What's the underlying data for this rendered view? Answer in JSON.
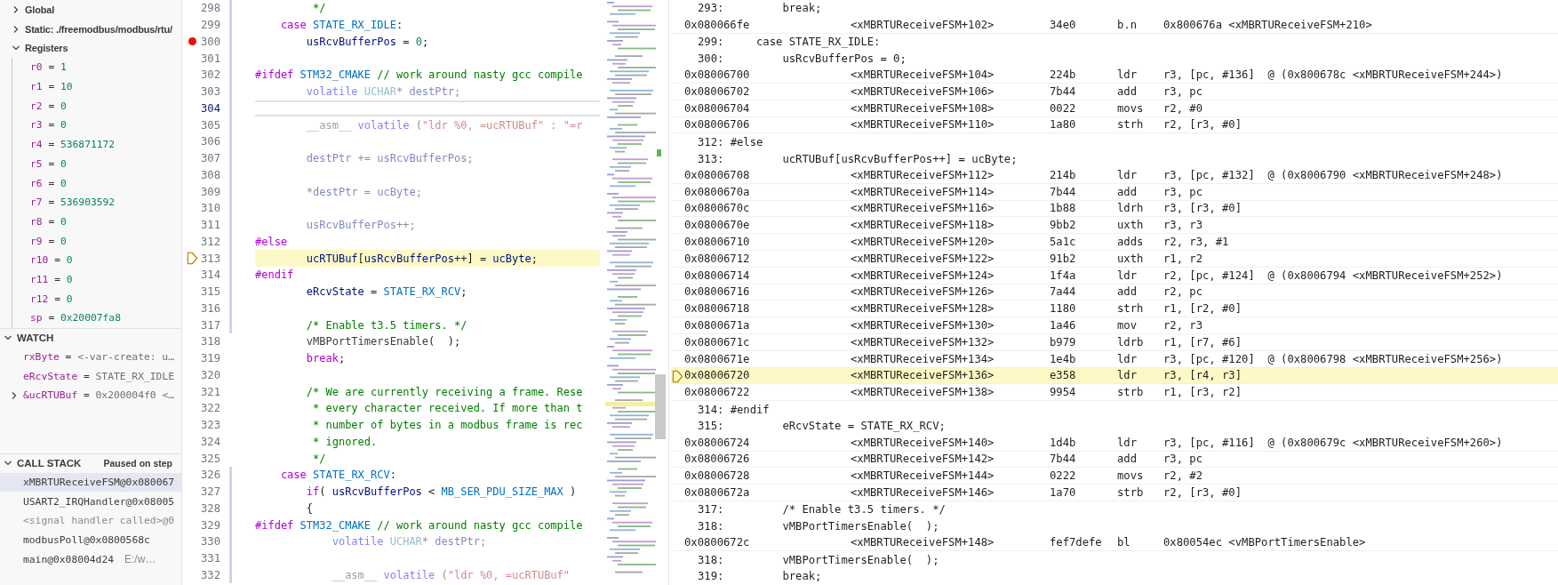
{
  "sidebar": {
    "scopes": [
      {
        "label": "Global",
        "expanded": false
      },
      {
        "label": "Static: ./freemodbus/modbus/rtu/",
        "expanded": false
      },
      {
        "label": "Registers",
        "expanded": true,
        "children": [
          {
            "name": "r0",
            "operator": "=",
            "value": "1"
          },
          {
            "name": "r1",
            "operator": "=",
            "value": "10"
          },
          {
            "name": "r2",
            "operator": "=",
            "value": "0"
          },
          {
            "name": "r3",
            "operator": "=",
            "value": "0"
          },
          {
            "name": "r4",
            "operator": "=",
            "value": "536871172"
          },
          {
            "name": "r5",
            "operator": "=",
            "value": "0"
          },
          {
            "name": "r6",
            "operator": "=",
            "value": "0"
          },
          {
            "name": "r7",
            "operator": "=",
            "value": "536903592"
          },
          {
            "name": "r8",
            "operator": "=",
            "value": "0"
          },
          {
            "name": "r9",
            "operator": "=",
            "value": "0"
          },
          {
            "name": "r10",
            "operator": "=",
            "value": "0"
          },
          {
            "name": "r11",
            "operator": "=",
            "value": "0"
          },
          {
            "name": "r12",
            "operator": "=",
            "value": "0"
          },
          {
            "name": "sp",
            "operator": "=",
            "value": "0x20007fa8"
          }
        ]
      }
    ],
    "watch": {
      "title": "WATCH",
      "expanded": true,
      "items": [
        {
          "name": "rxByte",
          "operator": "=",
          "value": "<-var-create: u…",
          "expandable": false
        },
        {
          "name": "eRcvState",
          "operator": "=",
          "value": "STATE_RX_IDLE",
          "expandable": false
        },
        {
          "name": "&ucRTUBuf",
          "operator": "=",
          "value": "0x200004f0 <…",
          "expandable": true
        }
      ]
    },
    "call_stack": {
      "title": "CALL STACK",
      "expanded": true,
      "status": "Paused on step",
      "frames": [
        {
          "label": "xMBRTUReceiveFSM@0x080067",
          "selected": true,
          "dimmed": false
        },
        {
          "label": "USART2_IRQHandler@0x08005",
          "selected": false,
          "dimmed": false
        },
        {
          "label": "<signal handler called>@0",
          "selected": false,
          "dimmed": true
        },
        {
          "label": "modbusPoll@0x0800568c",
          "selected": false,
          "dimmed": false
        },
        {
          "label": "main@0x08004d24",
          "source": "E:/w…",
          "selected": false,
          "dimmed": false
        }
      ]
    }
  },
  "editor": {
    "lines": [
      {
        "number": "298",
        "breakpoint": false,
        "current": false,
        "cursor": false,
        "inactive": false,
        "modified": true,
        "segments": [
          {
            "kind": "comment",
            "text": "         */"
          }
        ]
      },
      {
        "number": "299",
        "breakpoint": false,
        "current": false,
        "cursor": false,
        "inactive": false,
        "modified": true,
        "segments": [
          {
            "kind": "keyword",
            "text": "    case "
          },
          {
            "kind": "constant",
            "text": "STATE_RX_IDLE"
          },
          {
            "kind": "plain",
            "text": ":"
          }
        ]
      },
      {
        "number": "300",
        "breakpoint": true,
        "current": false,
        "cursor": false,
        "inactive": false,
        "modified": true,
        "segments": [
          {
            "kind": "variable",
            "text": "        usRcvBufferPos"
          },
          {
            "kind": "plain",
            "text": " = "
          },
          {
            "kind": "number",
            "text": "0"
          },
          {
            "kind": "plain",
            "text": ";"
          }
        ]
      },
      {
        "number": "301",
        "breakpoint": false,
        "current": false,
        "cursor": false,
        "modified": true
      },
      {
        "number": "302",
        "breakpoint": false,
        "current": false,
        "cursor": false,
        "inactive": false,
        "modified": true,
        "segments": [
          {
            "kind": "directive",
            "text": "#ifdef "
          },
          {
            "kind": "constant",
            "text": "STM32_CMAKE"
          },
          {
            "kind": "comment",
            "text": " // work around nasty gcc compile"
          }
        ]
      },
      {
        "number": "303",
        "breakpoint": false,
        "current": false,
        "cursor": false,
        "inactive": true,
        "modified": true,
        "segments": [
          {
            "kind": "storage",
            "text": "        volatile "
          },
          {
            "kind": "type",
            "text": "UCHAR"
          },
          {
            "kind": "plain",
            "text": "* "
          },
          {
            "kind": "variable",
            "text": "destPtr"
          },
          {
            "kind": "plain",
            "text": ";"
          }
        ]
      },
      {
        "number": "304",
        "breakpoint": false,
        "current": false,
        "cursor": true,
        "modified": true
      },
      {
        "number": "305",
        "breakpoint": false,
        "current": false,
        "cursor": false,
        "inactive": true,
        "modified": true,
        "segments": [
          {
            "kind": "function",
            "text": "        __asm__"
          },
          {
            "kind": "storage",
            "text": " volatile"
          },
          {
            "kind": "plain",
            "text": " ("
          },
          {
            "kind": "string",
            "text": "\"ldr %0, =ucRTUBuf\""
          },
          {
            "kind": "plain",
            "text": " : "
          },
          {
            "kind": "string",
            "text": "\"=r"
          }
        ]
      },
      {
        "number": "306",
        "breakpoint": false,
        "current": false,
        "cursor": false,
        "modified": true
      },
      {
        "number": "307",
        "breakpoint": false,
        "current": false,
        "cursor": false,
        "inactive": true,
        "modified": true,
        "segments": [
          {
            "kind": "variable",
            "text": "        destPtr"
          },
          {
            "kind": "plain",
            "text": " += "
          },
          {
            "kind": "variable",
            "text": "usRcvBufferPos"
          },
          {
            "kind": "plain",
            "text": ";"
          }
        ]
      },
      {
        "number": "308",
        "breakpoint": false,
        "current": false,
        "cursor": false,
        "modified": true
      },
      {
        "number": "309",
        "breakpoint": false,
        "current": false,
        "cursor": false,
        "inactive": true,
        "modified": true,
        "segments": [
          {
            "kind": "plain",
            "text": "        *"
          },
          {
            "kind": "variable",
            "text": "destPtr"
          },
          {
            "kind": "plain",
            "text": " = "
          },
          {
            "kind": "variable",
            "text": "ucByte"
          },
          {
            "kind": "plain",
            "text": ";"
          }
        ]
      },
      {
        "number": "310",
        "breakpoint": false,
        "current": false,
        "cursor": false,
        "modified": true
      },
      {
        "number": "311",
        "breakpoint": false,
        "current": false,
        "cursor": false,
        "inactive": true,
        "modified": true,
        "segments": [
          {
            "kind": "variable",
            "text": "        usRcvBufferPos"
          },
          {
            "kind": "plain",
            "text": "++;"
          }
        ]
      },
      {
        "number": "312",
        "breakpoint": false,
        "current": false,
        "cursor": false,
        "inactive": false,
        "modified": true,
        "segments": [
          {
            "kind": "directive",
            "text": "#else"
          }
        ]
      },
      {
        "number": "313",
        "breakpoint": false,
        "current": true,
        "cursor": false,
        "inactive": false,
        "modified": true,
        "segments": [
          {
            "kind": "variable",
            "text": "        ucRTUBuf"
          },
          {
            "kind": "plain",
            "text": "["
          },
          {
            "kind": "variable",
            "text": "usRcvBufferPos"
          },
          {
            "kind": "plain",
            "text": "++] = "
          },
          {
            "kind": "variable",
            "text": "ucByte"
          },
          {
            "kind": "plain",
            "text": ";"
          }
        ]
      },
      {
        "number": "314",
        "breakpoint": false,
        "current": false,
        "cursor": false,
        "inactive": false,
        "modified": true,
        "segments": [
          {
            "kind": "directive",
            "text": "#endif"
          }
        ]
      },
      {
        "number": "315",
        "breakpoint": false,
        "current": false,
        "cursor": false,
        "inactive": false,
        "modified": true,
        "segments": [
          {
            "kind": "variable",
            "text": "        eRcvState"
          },
          {
            "kind": "plain",
            "text": " = "
          },
          {
            "kind": "constant",
            "text": "STATE_RX_RCV"
          },
          {
            "kind": "plain",
            "text": ";"
          }
        ]
      },
      {
        "number": "316",
        "breakpoint": false,
        "current": false,
        "cursor": false,
        "modified": true
      },
      {
        "number": "317",
        "breakpoint": false,
        "current": false,
        "cursor": false,
        "inactive": false,
        "modified": true,
        "segments": [
          {
            "kind": "comment",
            "text": "        /* Enable t3.5 timers. */"
          }
        ]
      },
      {
        "number": "318",
        "breakpoint": false,
        "current": false,
        "cursor": false,
        "inactive": false,
        "modified": false,
        "segments": [
          {
            "kind": "function",
            "text": "        vMBPortTimersEnable"
          },
          {
            "kind": "plain",
            "text": "(  );"
          }
        ]
      },
      {
        "number": "319",
        "breakpoint": false,
        "current": false,
        "cursor": false,
        "inactive": false,
        "modified": false,
        "segments": [
          {
            "kind": "keyword",
            "text": "        break"
          },
          {
            "kind": "plain",
            "text": ";"
          }
        ]
      },
      {
        "number": "320",
        "breakpoint": false,
        "current": false,
        "cursor": false,
        "modified": false
      },
      {
        "number": "321",
        "breakpoint": false,
        "current": false,
        "cursor": false,
        "inactive": false,
        "modified": false,
        "segments": [
          {
            "kind": "comment",
            "text": "        /* We are currently receiving a frame. Rese"
          }
        ]
      },
      {
        "number": "322",
        "breakpoint": false,
        "current": false,
        "cursor": false,
        "inactive": false,
        "modified": false,
        "segments": [
          {
            "kind": "comment",
            "text": "         * every character received. If more than t"
          }
        ]
      },
      {
        "number": "323",
        "breakpoint": false,
        "current": false,
        "cursor": false,
        "inactive": false,
        "modified": false,
        "segments": [
          {
            "kind": "comment",
            "text": "         * number of bytes in a modbus frame is rec"
          }
        ]
      },
      {
        "number": "324",
        "breakpoint": false,
        "current": false,
        "cursor": false,
        "inactive": false,
        "modified": false,
        "segments": [
          {
            "kind": "comment",
            "text": "         * ignored."
          }
        ]
      },
      {
        "number": "325",
        "breakpoint": false,
        "current": false,
        "cursor": false,
        "inactive": false,
        "modified": false,
        "segments": [
          {
            "kind": "comment",
            "text": "         */"
          }
        ]
      },
      {
        "number": "326",
        "breakpoint": false,
        "current": false,
        "cursor": false,
        "inactive": false,
        "modified": true,
        "segments": [
          {
            "kind": "keyword",
            "text": "    case "
          },
          {
            "kind": "constant",
            "text": "STATE_RX_RCV"
          },
          {
            "kind": "plain",
            "text": ":"
          }
        ]
      },
      {
        "number": "327",
        "breakpoint": false,
        "current": false,
        "cursor": false,
        "inactive": false,
        "modified": true,
        "segments": [
          {
            "kind": "keyword",
            "text": "        if"
          },
          {
            "kind": "plain",
            "text": "( "
          },
          {
            "kind": "variable",
            "text": "usRcvBufferPos"
          },
          {
            "kind": "plain",
            "text": " < "
          },
          {
            "kind": "constant",
            "text": "MB_SER_PDU_SIZE_MAX"
          },
          {
            "kind": "plain",
            "text": " )"
          }
        ]
      },
      {
        "number": "328",
        "breakpoint": false,
        "current": false,
        "cursor": false,
        "inactive": false,
        "modified": true,
        "segments": [
          {
            "kind": "plain",
            "text": "        {"
          }
        ]
      },
      {
        "number": "329",
        "breakpoint": false,
        "current": false,
        "cursor": false,
        "inactive": false,
        "modified": true,
        "segments": [
          {
            "kind": "directive",
            "text": "#ifdef "
          },
          {
            "kind": "constant",
            "text": "STM32_CMAKE"
          },
          {
            "kind": "comment",
            "text": " // work around nasty gcc compile"
          }
        ]
      },
      {
        "number": "330",
        "breakpoint": false,
        "current": false,
        "cursor": false,
        "inactive": true,
        "modified": true,
        "segments": [
          {
            "kind": "storage",
            "text": "            volatile "
          },
          {
            "kind": "type",
            "text": "UCHAR"
          },
          {
            "kind": "plain",
            "text": "* "
          },
          {
            "kind": "variable",
            "text": "destPtr"
          },
          {
            "kind": "plain",
            "text": ";"
          }
        ]
      },
      {
        "number": "331",
        "breakpoint": false,
        "current": false,
        "cursor": false,
        "modified": true
      },
      {
        "number": "332",
        "breakpoint": false,
        "current": false,
        "cursor": false,
        "inactive": true,
        "modified": true,
        "segments": [
          {
            "kind": "function",
            "text": "            __asm__"
          },
          {
            "kind": "storage",
            "text": " volatile"
          },
          {
            "kind": "plain",
            "text": " ("
          },
          {
            "kind": "string",
            "text": "\"ldr %0, =ucRTUBuf\""
          }
        ]
      }
    ]
  },
  "disassembly": {
    "rows": [
      {
        "kind": "source",
        "text": "293:         break;"
      },
      {
        "kind": "instruction",
        "address": "0x080066fe",
        "symbol": "<xMBRTUReceiveFSM+102>",
        "opcode": "34e0",
        "mnemonic": "b.n",
        "operands": "0x800676a <xMBRTUReceiveFSM+210>",
        "current": false
      },
      {
        "kind": "source",
        "text": "299:     case STATE_RX_IDLE:"
      },
      {
        "kind": "source",
        "text": "300:         usRcvBufferPos = 0;"
      },
      {
        "kind": "instruction",
        "address": "0x08006700",
        "symbol": "<xMBRTUReceiveFSM+104>",
        "opcode": "224b",
        "mnemonic": "ldr",
        "operands": "r3, [pc, #136]  @ (0x800678c <xMBRTUReceiveFSM+244>)",
        "current": false
      },
      {
        "kind": "instruction",
        "address": "0x08006702",
        "symbol": "<xMBRTUReceiveFSM+106>",
        "opcode": "7b44",
        "mnemonic": "add",
        "operands": "r3, pc",
        "current": false
      },
      {
        "kind": "instruction",
        "address": "0x08006704",
        "symbol": "<xMBRTUReceiveFSM+108>",
        "opcode": "0022",
        "mnemonic": "movs",
        "operands": "r2, #0",
        "current": false
      },
      {
        "kind": "instruction",
        "address": "0x08006706",
        "symbol": "<xMBRTUReceiveFSM+110>",
        "opcode": "1a80",
        "mnemonic": "strh",
        "operands": "r2, [r3, #0]",
        "current": false
      },
      {
        "kind": "source",
        "text": "312: #else"
      },
      {
        "kind": "source",
        "text": "313:         ucRTUBuf[usRcvBufferPos++] = ucByte;"
      },
      {
        "kind": "instruction",
        "address": "0x08006708",
        "symbol": "<xMBRTUReceiveFSM+112>",
        "opcode": "214b",
        "mnemonic": "ldr",
        "operands": "r3, [pc, #132]  @ (0x8006790 <xMBRTUReceiveFSM+248>)",
        "current": false
      },
      {
        "kind": "instruction",
        "address": "0x0800670a",
        "symbol": "<xMBRTUReceiveFSM+114>",
        "opcode": "7b44",
        "mnemonic": "add",
        "operands": "r3, pc",
        "current": false
      },
      {
        "kind": "instruction",
        "address": "0x0800670c",
        "symbol": "<xMBRTUReceiveFSM+116>",
        "opcode": "1b88",
        "mnemonic": "ldrh",
        "operands": "r3, [r3, #0]",
        "current": false
      },
      {
        "kind": "instruction",
        "address": "0x0800670e",
        "symbol": "<xMBRTUReceiveFSM+118>",
        "opcode": "9bb2",
        "mnemonic": "uxth",
        "operands": "r3, r3",
        "current": false
      },
      {
        "kind": "instruction",
        "address": "0x08006710",
        "symbol": "<xMBRTUReceiveFSM+120>",
        "opcode": "5a1c",
        "mnemonic": "adds",
        "operands": "r2, r3, #1",
        "current": false
      },
      {
        "kind": "instruction",
        "address": "0x08006712",
        "symbol": "<xMBRTUReceiveFSM+122>",
        "opcode": "91b2",
        "mnemonic": "uxth",
        "operands": "r1, r2",
        "current": false
      },
      {
        "kind": "instruction",
        "address": "0x08006714",
        "symbol": "<xMBRTUReceiveFSM+124>",
        "opcode": "1f4a",
        "mnemonic": "ldr",
        "operands": "r2, [pc, #124]  @ (0x8006794 <xMBRTUReceiveFSM+252>)",
        "current": false
      },
      {
        "kind": "instruction",
        "address": "0x08006716",
        "symbol": "<xMBRTUReceiveFSM+126>",
        "opcode": "7a44",
        "mnemonic": "add",
        "operands": "r2, pc",
        "current": false
      },
      {
        "kind": "instruction",
        "address": "0x08006718",
        "symbol": "<xMBRTUReceiveFSM+128>",
        "opcode": "1180",
        "mnemonic": "strh",
        "operands": "r1, [r2, #0]",
        "current": false
      },
      {
        "kind": "instruction",
        "address": "0x0800671a",
        "symbol": "<xMBRTUReceiveFSM+130>",
        "opcode": "1a46",
        "mnemonic": "mov",
        "operands": "r2, r3",
        "current": false
      },
      {
        "kind": "instruction",
        "address": "0x0800671c",
        "symbol": "<xMBRTUReceiveFSM+132>",
        "opcode": "b979",
        "mnemonic": "ldrb",
        "operands": "r1, [r7, #6]",
        "current": false
      },
      {
        "kind": "instruction",
        "address": "0x0800671e",
        "symbol": "<xMBRTUReceiveFSM+134>",
        "opcode": "1e4b",
        "mnemonic": "ldr",
        "operands": "r3, [pc, #120]  @ (0x8006798 <xMBRTUReceiveFSM+256>)",
        "current": false
      },
      {
        "kind": "instruction",
        "address": "0x08006720",
        "symbol": "<xMBRTUReceiveFSM+136>",
        "opcode": "e358",
        "mnemonic": "ldr",
        "operands": "r3, [r4, r3]",
        "current": true
      },
      {
        "kind": "instruction",
        "address": "0x08006722",
        "symbol": "<xMBRTUReceiveFSM+138>",
        "opcode": "9954",
        "mnemonic": "strb",
        "operands": "r1, [r3, r2]",
        "current": false
      },
      {
        "kind": "source",
        "text": "314: #endif"
      },
      {
        "kind": "source",
        "text": "315:         eRcvState = STATE_RX_RCV;"
      },
      {
        "kind": "instruction",
        "address": "0x08006724",
        "symbol": "<xMBRTUReceiveFSM+140>",
        "opcode": "1d4b",
        "mnemonic": "ldr",
        "operands": "r3, [pc, #116]  @ (0x800679c <xMBRTUReceiveFSM+260>)",
        "current": false
      },
      {
        "kind": "instruction",
        "address": "0x08006726",
        "symbol": "<xMBRTUReceiveFSM+142>",
        "opcode": "7b44",
        "mnemonic": "add",
        "operands": "r3, pc",
        "current": false
      },
      {
        "kind": "instruction",
        "address": "0x08006728",
        "symbol": "<xMBRTUReceiveFSM+144>",
        "opcode": "0222",
        "mnemonic": "movs",
        "operands": "r2, #2",
        "current": false
      },
      {
        "kind": "instruction",
        "address": "0x0800672a",
        "symbol": "<xMBRTUReceiveFSM+146>",
        "opcode": "1a70",
        "mnemonic": "strb",
        "operands": "r2, [r3, #0]",
        "current": false
      },
      {
        "kind": "source",
        "text": "317:         /* Enable t3.5 timers. */"
      },
      {
        "kind": "source",
        "text": "318:         vMBPortTimersEnable(  );"
      },
      {
        "kind": "instruction",
        "address": "0x0800672c",
        "symbol": "<xMBRTUReceiveFSM+148>",
        "opcode": "fef7defe",
        "mnemonic": "bl",
        "operands": "0x80054ec <vMBPortTimersEnable>",
        "current": false
      },
      {
        "kind": "source",
        "text": "318:         vMBPortTimersEnable(  );"
      },
      {
        "kind": "source",
        "text": "319:         break;"
      }
    ]
  }
}
